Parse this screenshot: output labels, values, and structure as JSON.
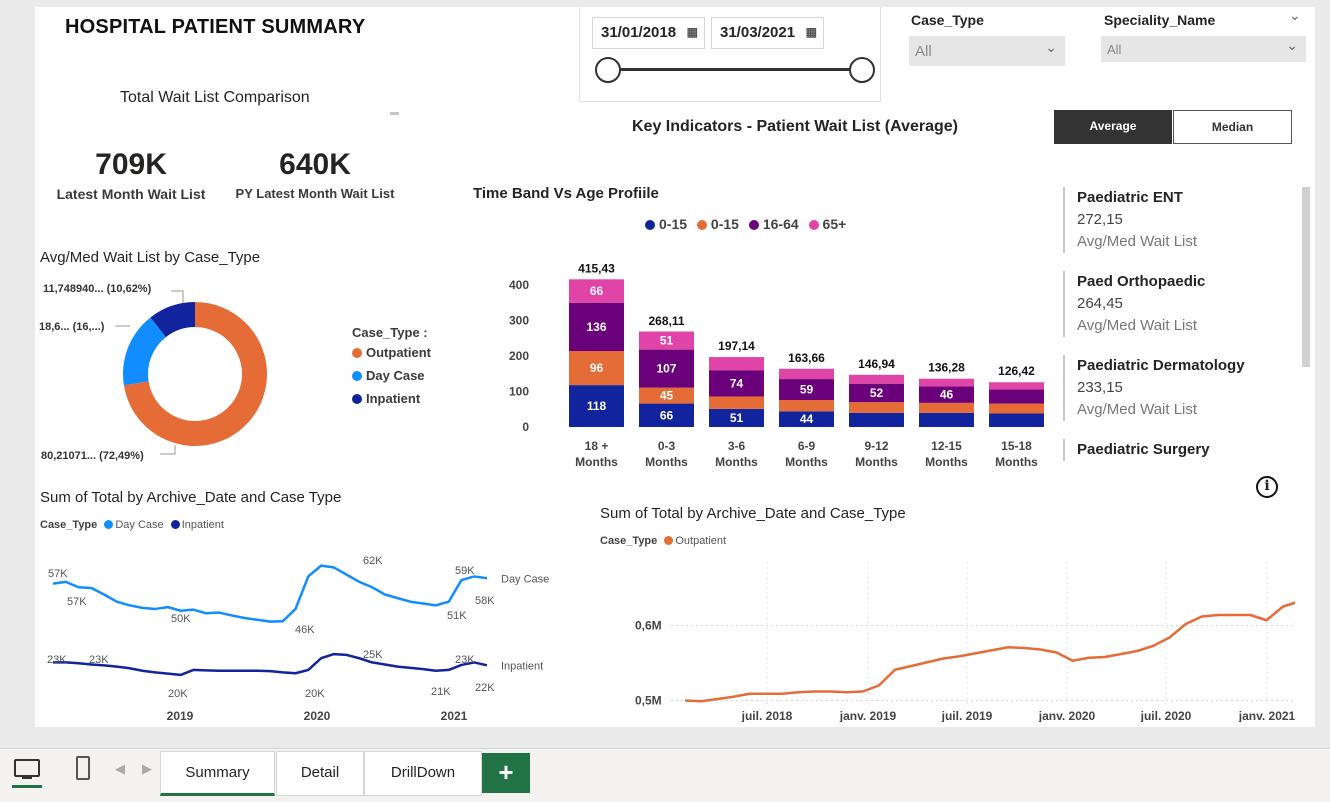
{
  "report": {
    "title": "HOSPITAL PATIENT SUMMARY"
  },
  "date_slicer": {
    "start": "31/01/2018",
    "end": "31/03/2021"
  },
  "case_type_slicer": {
    "label": "Case_Type",
    "value": "All"
  },
  "speciality_slicer": {
    "label": "Speciality_Name",
    "value": "All"
  },
  "wait_list_comparison": {
    "title": "Total Wait List Comparison"
  },
  "kpis": [
    {
      "value": "709K",
      "label": "Latest Month Wait List"
    },
    {
      "value": "640K",
      "label": "PY Latest Month Wait List"
    }
  ],
  "key_indicators": {
    "title": "Key Indicators - Patient Wait List (Average)"
  },
  "toggle": {
    "average": "Average",
    "median": "Median"
  },
  "donut": {
    "title": "Avg/Med Wait List by Case_Type",
    "legend_title": "Case_Type :",
    "slices": [
      {
        "name": "Outpatient",
        "label": "80,21071... (72,49%)",
        "pct": 72.49,
        "color": "#e66c37"
      },
      {
        "name": "Day Case",
        "label": "18,6... (16,...)",
        "pct": 16.89,
        "color": "#118dff"
      },
      {
        "name": "Inpatient",
        "label": "11,748940... (10,62%)",
        "pct": 10.62,
        "color": "#12239e"
      }
    ]
  },
  "stacked": {
    "title": "Time Band Vs Age Profiile",
    "legend": [
      {
        "name": "0-15",
        "color": "#12239e"
      },
      {
        "name": "0-15",
        "color": "#e66c37"
      },
      {
        "name": "16-64",
        "color": "#6b007b"
      },
      {
        "name": "65+",
        "color": "#e044a7"
      }
    ]
  },
  "chart_data": [
    {
      "type": "bar",
      "title": "Time Band Vs Age Profiile",
      "stacked": true,
      "categories": [
        "18 + Months",
        "0-3 Months",
        "3-6 Months",
        "6-9 Months",
        "9-12 Months",
        "12-15 Months",
        "15-18 Months"
      ],
      "totals": [
        "415,43",
        "268,11",
        "197,14",
        "163,66",
        "146,94",
        "136,28",
        "126,42"
      ],
      "totals_num": [
        415.43,
        268.11,
        197.14,
        163.66,
        146.94,
        136.28,
        126.42
      ],
      "ylim": [
        0,
        400
      ],
      "yticks": [
        0,
        100,
        200,
        300,
        400
      ],
      "series": [
        {
          "name": "0-15",
          "color": "#12239e",
          "values": [
            118,
            66,
            51,
            44,
            40,
            40,
            38
          ],
          "labels": [
            "118",
            "66",
            "51",
            "44",
            "",
            "",
            ""
          ]
        },
        {
          "name": "0-15",
          "color": "#e66c37",
          "values": [
            96,
            45,
            35,
            32,
            30,
            28,
            28
          ],
          "labels": [
            "96",
            "45",
            "",
            "",
            "",
            "",
            ""
          ]
        },
        {
          "name": "16-64",
          "color": "#6b007b",
          "values": [
            136,
            107,
            74,
            59,
            52,
            46,
            40
          ],
          "labels": [
            "136",
            "107",
            "74",
            "59",
            "52",
            "46",
            ""
          ]
        },
        {
          "name": "65+",
          "color": "#e044a7",
          "values": [
            66,
            51,
            37,
            29,
            25,
            22,
            20
          ],
          "labels": [
            "66",
            "51",
            "",
            "",
            "",
            "",
            ""
          ]
        }
      ]
    },
    {
      "type": "line",
      "title": "Sum of Total by Archive_Date and Case_Type",
      "legend_title": "Case_Type",
      "x_ticks": [
        "2019",
        "2020",
        "2021"
      ],
      "series": [
        {
          "name": "Day Case",
          "color": "#118dff",
          "values": [
            57,
            57.5,
            56,
            55.8,
            54,
            52,
            51,
            50.3,
            50,
            50.5,
            49.5,
            49.8,
            48.8,
            49,
            48.2,
            47.5,
            47,
            46.5,
            46.6,
            50,
            59,
            62,
            61.5,
            59.5,
            57.5,
            56,
            54,
            53,
            52,
            51.5,
            51,
            52,
            58,
            59,
            58.5
          ],
          "annotations": [
            "57K",
            "57K",
            "50K",
            "46K",
            "62K",
            "51K",
            "59K",
            "58K"
          ]
        },
        {
          "name": "Inpatient",
          "color": "#12239e",
          "values": [
            23,
            23,
            22.8,
            22.5,
            22.3,
            22,
            21.6,
            21,
            20.6,
            20.3,
            20,
            21.2,
            21.1,
            21,
            21,
            21,
            21,
            20.9,
            20.6,
            20.4,
            21.2,
            24,
            25,
            24.8,
            24,
            23,
            22.5,
            22,
            21.7,
            21.4,
            21,
            21.2,
            22.4,
            23,
            22.3
          ],
          "annotations": [
            "23K",
            "23K",
            "20K",
            "20K",
            "25K",
            "21K",
            "23K",
            "22K"
          ]
        }
      ]
    },
    {
      "type": "line",
      "title": "Sum of Total by Archive_Date and Case_Type",
      "legend_title": "Case_Type",
      "x_ticks": [
        "juil. 2018",
        "janv. 2019",
        "juil. 2019",
        "janv. 2020",
        "juil. 2020",
        "janv. 2021"
      ],
      "y_ticks": [
        "0,5M",
        "0,6M"
      ],
      "ylim": [
        0.49,
        0.69
      ],
      "series": [
        {
          "name": "Outpatient",
          "color": "#e66c37",
          "values": [
            0.5,
            0.499,
            0.502,
            0.505,
            0.509,
            0.509,
            0.509,
            0.511,
            0.512,
            0.512,
            0.511,
            0.512,
            0.52,
            0.541,
            0.546,
            0.551,
            0.556,
            0.559,
            0.563,
            0.567,
            0.571,
            0.57,
            0.568,
            0.564,
            0.553,
            0.557,
            0.558,
            0.562,
            0.566,
            0.573,
            0.584,
            0.602,
            0.612,
            0.614,
            0.614,
            0.614,
            0.607,
            0.625,
            0.632,
            0.633
          ]
        }
      ]
    }
  ],
  "side_list": [
    {
      "name": "Paediatric ENT",
      "value": "272,15",
      "label": "Avg/Med Wait List"
    },
    {
      "name": "Paed Orthopaedic",
      "value": "264,45",
      "label": "Avg/Med Wait List"
    },
    {
      "name": "Paediatric Dermatology",
      "value": "233,15",
      "label": "Avg/Med Wait List"
    },
    {
      "name": "Paediatric Surgery",
      "value": "",
      "label": ""
    }
  ],
  "line1": {
    "title": "Sum of Total by Archive_Date and Case  Type",
    "legend_title": "Case_Type",
    "legend": [
      {
        "name": "Day Case",
        "color": "#118dff"
      },
      {
        "name": "Inpatient",
        "color": "#12239e"
      }
    ]
  },
  "line2": {
    "title": "Sum of Total by Archive_Date and Case_Type",
    "legend_title": "Case_Type",
    "legend": [
      {
        "name": "Outpatient",
        "color": "#e66c37"
      }
    ]
  },
  "tabs": [
    {
      "label": "Summary",
      "active": true
    },
    {
      "label": "Detail",
      "active": false
    },
    {
      "label": "DrillDown",
      "active": false
    }
  ],
  "tabbar": {
    "add": "+"
  }
}
